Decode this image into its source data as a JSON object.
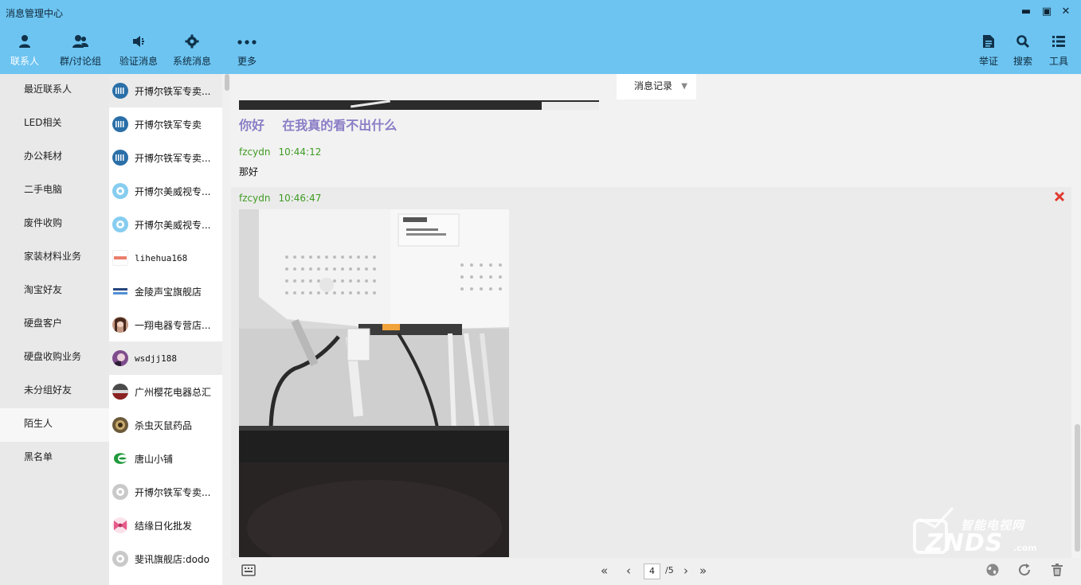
{
  "window": {
    "title": "消息管理中心",
    "controls": {
      "minimize": "▬",
      "maximize": "▣",
      "close": "✕"
    }
  },
  "toolbar": {
    "left": [
      {
        "label": "联系人",
        "icon": "person-icon"
      },
      {
        "label": "群/讨论组",
        "icon": "group-icon"
      },
      {
        "label": "验证消息",
        "icon": "speaker-icon"
      },
      {
        "label": "系统消息",
        "icon": "gear-icon"
      },
      {
        "label": "更多",
        "icon": "more-dots-icon"
      }
    ],
    "right": [
      {
        "label": "举证",
        "icon": "document-icon"
      },
      {
        "label": "搜索",
        "icon": "search-icon"
      },
      {
        "label": "工具",
        "icon": "list-icon"
      }
    ]
  },
  "groups": [
    "最近联系人",
    "LED相关",
    "办公耗材",
    "二手电脑",
    "废件收购",
    "家装材料业务",
    "淘宝好友",
    "硬盘客户",
    "硬盘收购业务",
    "未分组好友",
    "陌生人",
    "黑名单"
  ],
  "contacts": [
    {
      "name": "开博尔铁军专卖...",
      "avatar": "brand-blue-icon"
    },
    {
      "name": "开博尔铁军专卖",
      "avatar": "brand-blue-icon"
    },
    {
      "name": "开博尔铁军专卖...",
      "avatar": "brand-blue-icon"
    },
    {
      "name": "开博尔美威视专...",
      "avatar": "default-avatar-icon"
    },
    {
      "name": "开博尔美威视专...",
      "avatar": "default-avatar-icon"
    },
    {
      "name": "lihehua168",
      "avatar": "shop-logo-icon"
    },
    {
      "name": "金陵声宝旗舰店",
      "avatar": "shop-logo-icon"
    },
    {
      "name": "一翔电器专营店...",
      "avatar": "photo-avatar-icon"
    },
    {
      "name": "wsdjj188",
      "avatar": "photo-avatar-icon"
    },
    {
      "name": "广州樱花电器总汇",
      "avatar": "photo-avatar-icon"
    },
    {
      "name": "杀虫灭鼠药品",
      "avatar": "photo-avatar-icon"
    },
    {
      "name": "唐山小铺",
      "avatar": "green-logo-icon"
    },
    {
      "name": "开博尔铁军专卖...",
      "avatar": "default-avatar-icon"
    },
    {
      "name": "结缘日化批发",
      "avatar": "bow-avatar-icon"
    },
    {
      "name": "斐讯旗舰店:dodo",
      "avatar": "default-avatar-icon"
    }
  ],
  "records_tab": {
    "label": "消息记录",
    "arrow": "▼"
  },
  "messages": {
    "big_text": "你好    在我真的看不出什么",
    "msg1": {
      "sender": "fzcydn",
      "time": "10:44:12",
      "body": "那好"
    },
    "msg2": {
      "sender": "fzcydn",
      "time": "10:46:47"
    }
  },
  "pagination": {
    "first": "«",
    "prev": "‹",
    "current": "4",
    "total": "/5",
    "next": "›",
    "last": "»"
  },
  "watermark": {
    "cn": "智能电视网",
    "en": "ZNDS",
    "suffix": ".com"
  },
  "colors": {
    "header_bg": "#6dc4f1",
    "sender_green": "#3f9b23",
    "big_text_purple": "#8a7dc6",
    "close_red": "#e03a2f"
  }
}
